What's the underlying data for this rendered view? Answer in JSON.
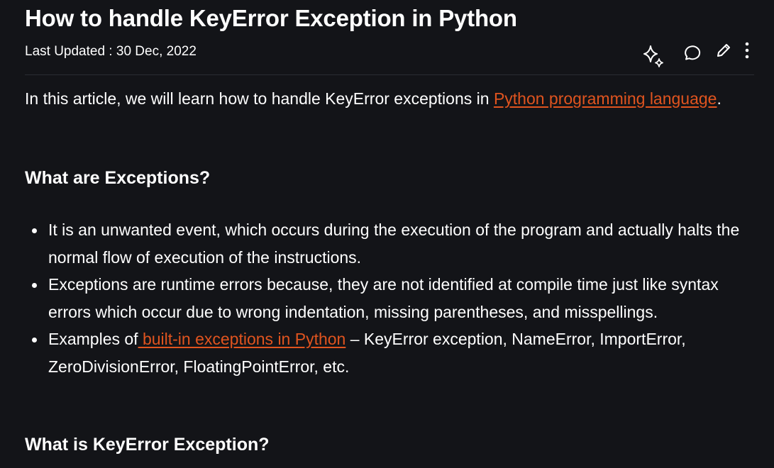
{
  "article": {
    "title": "How to handle KeyError Exception in Python",
    "last_updated_label": "Last Updated : ",
    "last_updated_date": "30 Dec, 2022"
  },
  "toolbar": {
    "icons": [
      "sparkle-ai-icon",
      "comment-icon",
      "edit-pencil-icon",
      "more-options-icon"
    ]
  },
  "intro": {
    "text_before": "In this article, we will learn how to handle KeyError exceptions in ",
    "link_text": "Python programming language",
    "text_after": "."
  },
  "section_exceptions": {
    "heading": "What are Exceptions?",
    "bullets": [
      {
        "text": "It is an unwanted event, which occurs during the execution of the program and actually halts the normal flow of execution of the instructions."
      },
      {
        "text": "Exceptions are runtime errors because, they are not identified at compile time just like syntax errors which occur due to wrong indentation, missing parentheses, and misspellings."
      },
      {
        "text_before": "Examples of",
        "link_text": " built-in exceptions in Python",
        "text_after": " – KeyError exception, NameError, ImportError, ZeroDivisionError, FloatingPointError, etc."
      }
    ]
  },
  "section_keyerror": {
    "heading": "What is KeyError Exception?"
  },
  "colors": {
    "background": "#131418",
    "text": "#ffffff",
    "link": "#e0541f"
  }
}
